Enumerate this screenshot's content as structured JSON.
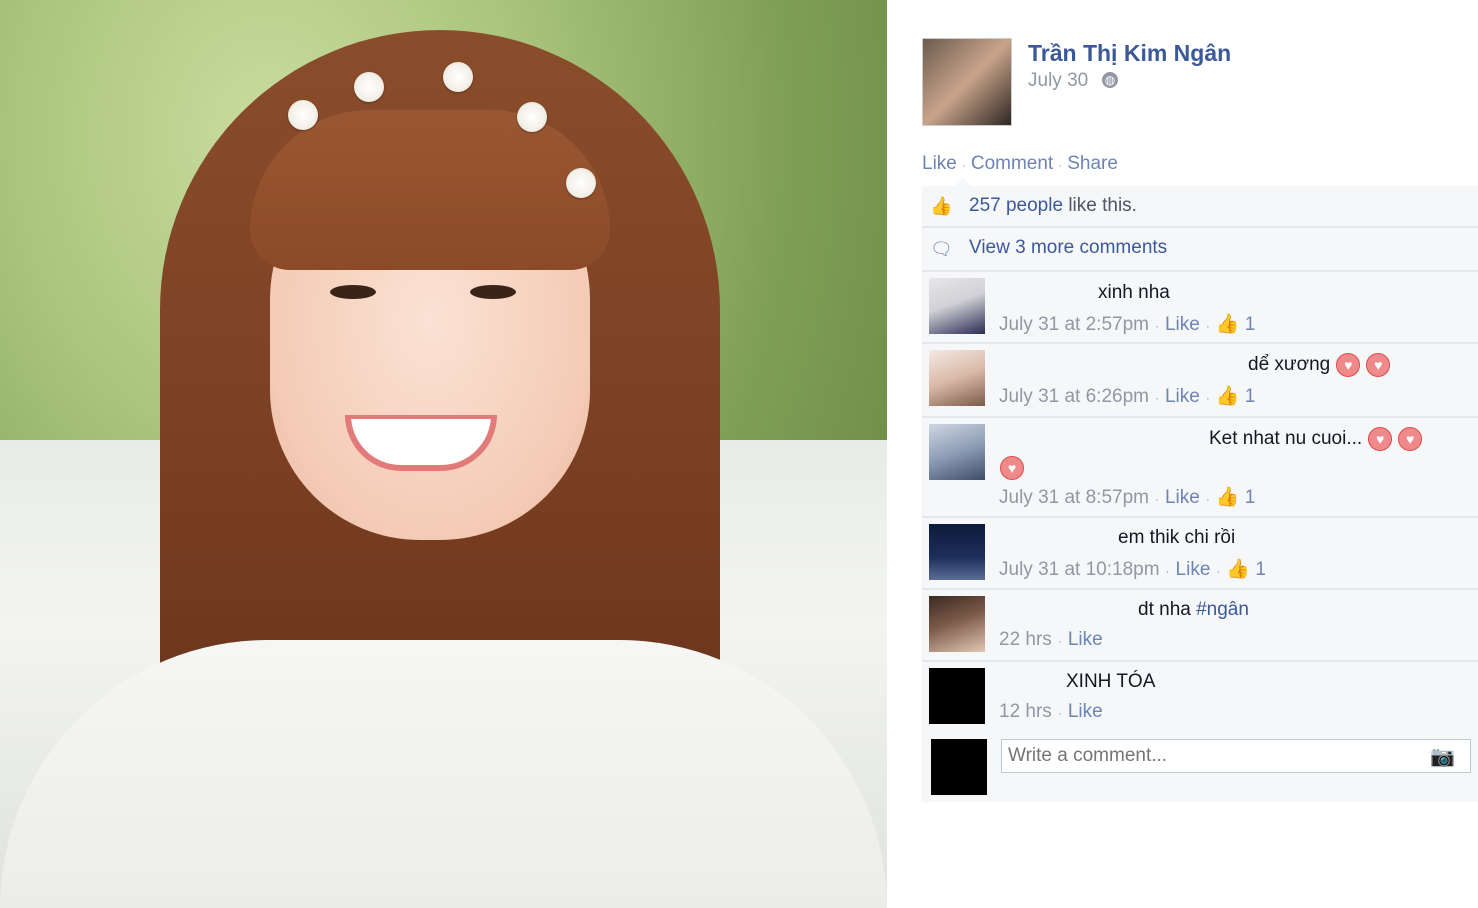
{
  "post": {
    "author": "Trần Thị Kim Ngân",
    "date": "July 30",
    "actions": [
      "Like",
      "Comment",
      "Share"
    ]
  },
  "likes": {
    "count_link": "257 people",
    "suffix": " like this."
  },
  "more_comments": "View 3 more comments",
  "comments": [
    {
      "text": "xinh nha",
      "time": "July 31 at 2:57pm",
      "like": "Like",
      "like_count": "1",
      "hearts": 0
    },
    {
      "text": "dể xương",
      "time": "July 31 at 6:26pm",
      "like": "Like",
      "like_count": "1",
      "hearts": 2
    },
    {
      "text": "Ket nhat nu cuoi...",
      "time": "July 31 at 8:57pm",
      "like": "Like",
      "like_count": "1",
      "hearts": 3
    },
    {
      "text": "em thik chi rồi",
      "time": "July 31 at 10:18pm",
      "like": "Like",
      "like_count": "1",
      "hearts": 0
    },
    {
      "text": "dt nha ",
      "hashtag": "#ngân",
      "time": "22 hrs",
      "like": "Like"
    },
    {
      "text": "XINH TÓA",
      "time": "12 hrs",
      "like": "Like"
    }
  ],
  "write_comment": {
    "placeholder": "Write a comment..."
  },
  "icons": {
    "globe": "globe-icon",
    "like_thumb": "thumbs-up-icon",
    "comments": "speech-bubble-icon",
    "camera": "camera-icon",
    "heart": "heart-emoticon"
  },
  "colors": {
    "link": "#3b5998",
    "muted": "#9197a3",
    "panel_bg": "#f6f7f9"
  }
}
